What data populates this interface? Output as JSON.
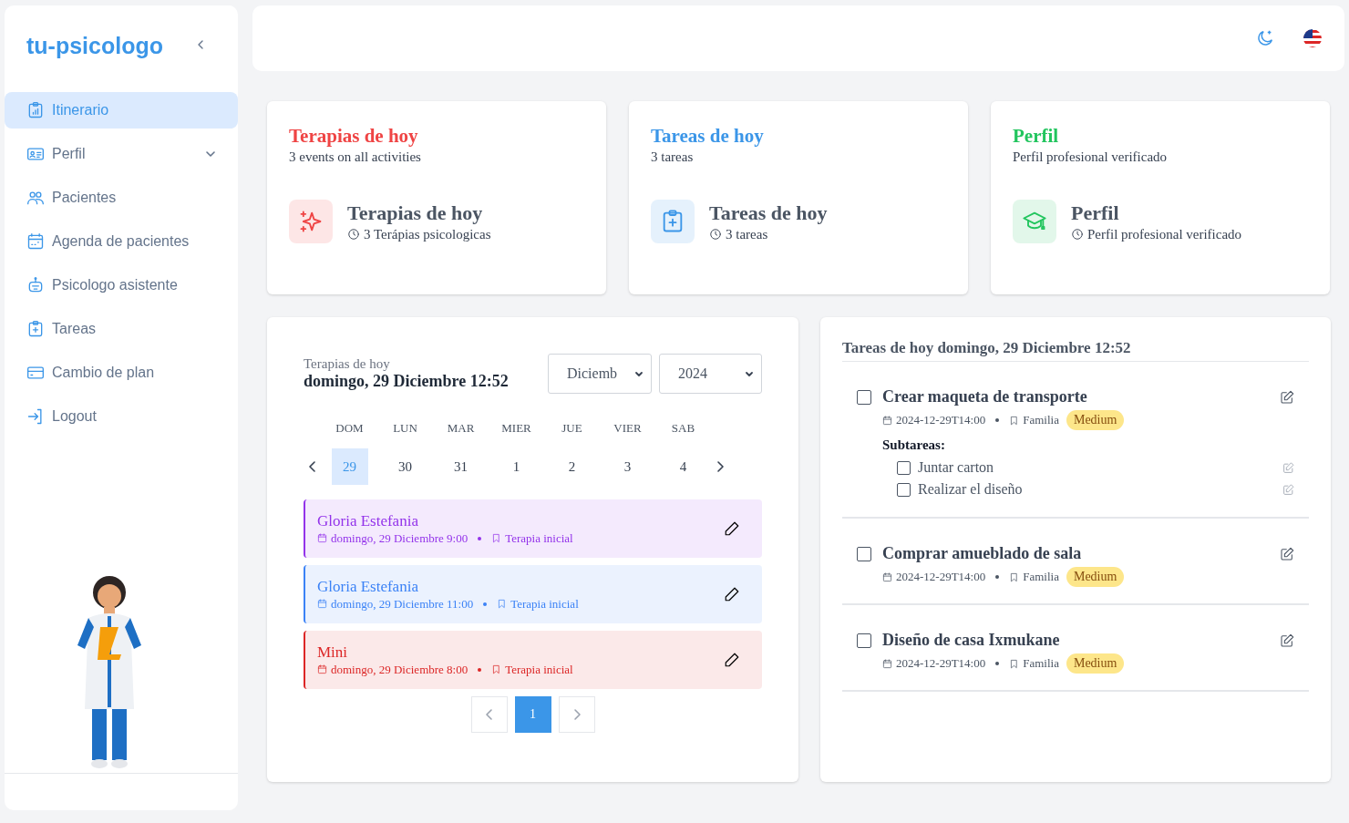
{
  "sidebar": {
    "brand": "tu-psicologo",
    "items": [
      {
        "label": "Itinerario",
        "kind": "link",
        "selected": true
      },
      {
        "label": "Perfil",
        "kind": "group",
        "selected": false,
        "expanded": false
      },
      {
        "label": "Pacientes",
        "kind": "link",
        "selected": false
      },
      {
        "label": "Agenda de pacientes",
        "kind": "link",
        "selected": false
      },
      {
        "label": "Psicologo asistente",
        "kind": "link",
        "selected": false
      },
      {
        "label": "Tareas",
        "kind": "link",
        "selected": false
      },
      {
        "label": "Cambio de plan",
        "kind": "link",
        "selected": false
      },
      {
        "label": "Logout",
        "kind": "link",
        "selected": false
      }
    ]
  },
  "summary_cards": [
    {
      "title": "Terapias de hoy",
      "subtitle": "3 events on all activities",
      "heading": "Terapias de hoy",
      "detail": "3 Terápias psicologicas",
      "color": "#ef4444"
    },
    {
      "title": "Tareas de hoy",
      "subtitle": "3 tareas",
      "heading": "Tareas de hoy",
      "detail": "3 tareas",
      "color": "#3b96e8"
    },
    {
      "title": "Perfil",
      "subtitle": "Perfil profesional verificado",
      "heading": "Perfil",
      "detail": "Perfil profesional verificado",
      "color": "#22c55e"
    }
  ],
  "calendar": {
    "caption": "Terapias de hoy",
    "date": "domingo, 29 Diciembre 12:52",
    "month_select": "Diciemb",
    "year_select": "2024",
    "weekdays": [
      "DOM",
      "LUN",
      "MAR",
      "MIER",
      "JUE",
      "VIER",
      "SAB"
    ],
    "days": [
      {
        "label": "29",
        "selected": true
      },
      {
        "label": "30",
        "selected": false
      },
      {
        "label": "31",
        "selected": false
      },
      {
        "label": "1",
        "selected": false
      },
      {
        "label": "2",
        "selected": false
      },
      {
        "label": "3",
        "selected": false
      },
      {
        "label": "4",
        "selected": false
      }
    ],
    "events": [
      {
        "name": "Gloria Estefania",
        "date": "domingo, 29 Diciembre 9:00",
        "type": "Terapia inicial",
        "color": "#9333ea"
      },
      {
        "name": "Gloria Estefania",
        "date": "domingo, 29 Diciembre 11:00",
        "type": "Terapia inicial",
        "color": "#3b82f6"
      },
      {
        "name": "Mini",
        "date": "domingo, 29 Diciembre 8:00",
        "type": "Terapia inicial",
        "color": "#dc2626"
      }
    ],
    "pages": [
      {
        "label": "1",
        "selected": true
      }
    ]
  },
  "tasks": {
    "title": "Tareas de hoy domingo, 29 Diciembre 12:52",
    "items": [
      {
        "title": "Crear maqueta de transporte",
        "checked": false,
        "date": "2024-12-29T14:00",
        "category": "Familia",
        "priority": "Medium",
        "subtasks_label": "Subtareas:",
        "subtasks": [
          {
            "title": "Juntar carton",
            "checked": false
          },
          {
            "title": "Realizar el diseño",
            "checked": false
          }
        ]
      },
      {
        "title": "Comprar amueblado de sala",
        "checked": false,
        "date": "2024-12-29T14:00",
        "category": "Familia",
        "priority": "Medium"
      },
      {
        "title": "Diseño de casa Ixmukane",
        "checked": false,
        "date": "2024-12-29T14:00",
        "category": "Familia",
        "priority": "Medium"
      }
    ]
  }
}
